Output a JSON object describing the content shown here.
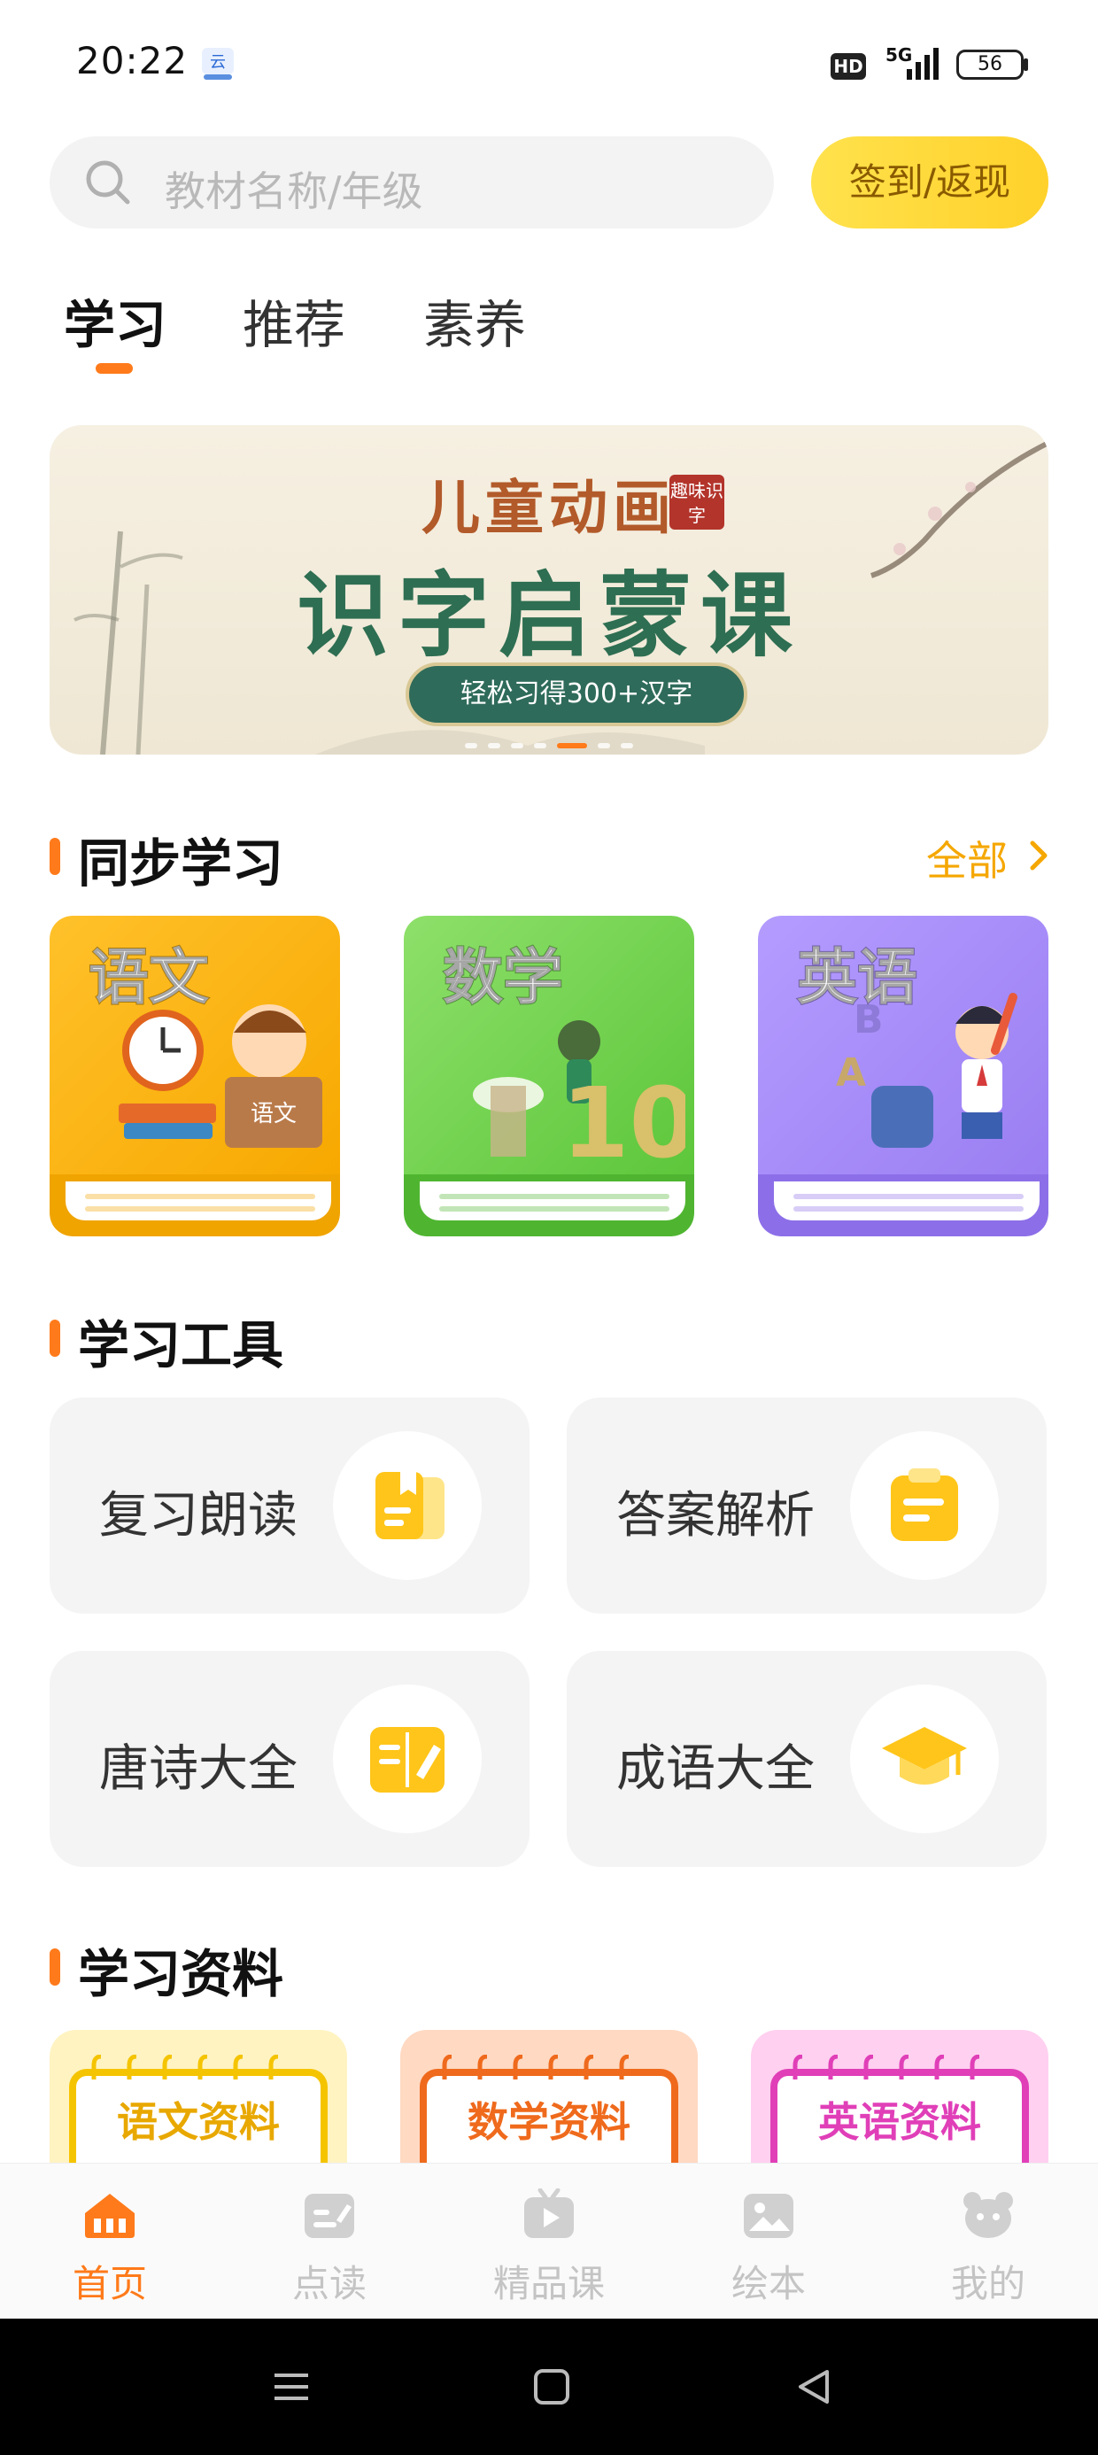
{
  "status_bar": {
    "time": "20:22",
    "network": "5G",
    "hd": "HD",
    "battery": "56"
  },
  "search": {
    "placeholder": "教材名称/年级",
    "checkin_label": "签到/返现"
  },
  "tabs": [
    {
      "label": "学习",
      "active": true
    },
    {
      "label": "推荐",
      "active": false
    },
    {
      "label": "素养",
      "active": false
    }
  ],
  "banner": {
    "subtitle": "儿童动画",
    "stamp": "趣味识字",
    "title": "识字启蒙课",
    "pill": "轻松习得300+汉字",
    "slide_count": 7,
    "active_slide": 4
  },
  "sync": {
    "title": "同步学习",
    "see_all": "全部",
    "books": [
      {
        "label": "语文",
        "color": "#f7b500"
      },
      {
        "label": "数学",
        "color": "#6fce4a"
      },
      {
        "label": "英语",
        "color": "#a88cf7"
      }
    ]
  },
  "tools": {
    "title": "学习工具",
    "items": [
      {
        "label": "复习朗读",
        "icon": "book-icon"
      },
      {
        "label": "答案解析",
        "icon": "document-icon"
      },
      {
        "label": "唐诗大全",
        "icon": "poem-book-icon"
      },
      {
        "label": "成语大全",
        "icon": "graduation-cap-icon"
      }
    ]
  },
  "materials": {
    "title": "学习资料",
    "items": [
      {
        "label": "语文资料",
        "color": "#f5c400"
      },
      {
        "label": "数学资料",
        "color": "#ef6a1c"
      },
      {
        "label": "英语资料",
        "color": "#e03fb8"
      }
    ]
  },
  "nav": [
    {
      "label": "首页",
      "icon": "home-icon",
      "active": true
    },
    {
      "label": "点读",
      "icon": "point-read-icon",
      "active": false
    },
    {
      "label": "精品课",
      "icon": "video-course-icon",
      "active": false
    },
    {
      "label": "绘本",
      "icon": "picture-book-icon",
      "active": false
    },
    {
      "label": "我的",
      "icon": "profile-icon",
      "active": false
    }
  ],
  "colors": {
    "accent": "#ff7a1a",
    "yellow": "#ffd12a"
  }
}
